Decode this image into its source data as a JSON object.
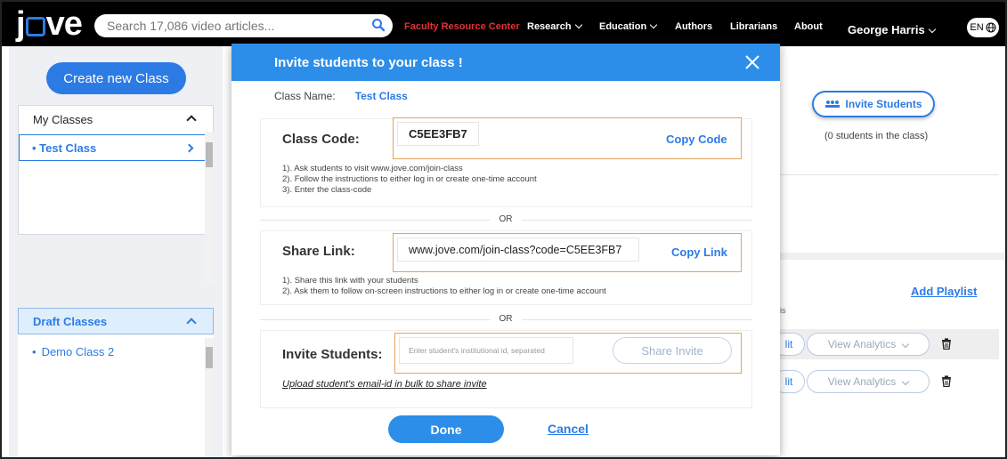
{
  "nav": {
    "logo": "jove",
    "search_placeholder": "Search 17,086 video articles...",
    "faculty": "Faculty Resource Center",
    "research": "Research",
    "education": "Education",
    "authors": "Authors",
    "librarians": "Librarians",
    "about": "About",
    "user": "George Harris",
    "lang": "EN"
  },
  "sidebar": {
    "create_label": "Create new Class",
    "my_classes_label": "My Classes",
    "my_classes": [
      "Test Class"
    ],
    "draft_label": "Draft Classes",
    "drafts": [
      "Demo Class 2"
    ]
  },
  "background": {
    "invite_label": "Invite Students",
    "student_count": "(0 students in the class)",
    "add_playlist": "Add Playlist",
    "edit_fragment": "lit",
    "analytics_label": "View Analytics",
    "col_fragment": "is"
  },
  "modal": {
    "title": "Invite students to your class !",
    "class_name_label": "Class Name:",
    "class_name": "Test Class",
    "class_code_label": "Class Code:",
    "class_code": "C5EE3FB7",
    "copy_code": "Copy Code",
    "code_steps": [
      "1). Ask students to visit www.jove.com/join-class",
      "2). Follow the instructions to either log in or create one-time account",
      "3). Enter the class-code"
    ],
    "or": "OR",
    "share_link_label": "Share Link:",
    "share_link": "www.jove.com/join-class?code=C5EE3FB7",
    "copy_link": "Copy Link",
    "link_steps": [
      "1). Share this link with your students",
      "2). Ask them to follow on-screen instructions to either log in or create one-time account"
    ],
    "invite_label": "Invite Students:",
    "invite_placeholder": "Enter student's institutional id, separated",
    "share_invite": "Share Invite",
    "upload_link": "Upload student's email-id in bulk to share invite",
    "done": "Done",
    "cancel": "Cancel"
  },
  "colors": {
    "accent": "#2c7be5",
    "header_blue": "#2c8ee8",
    "highlight_border": "#e6a35c",
    "nav_red": "#e0323a"
  }
}
